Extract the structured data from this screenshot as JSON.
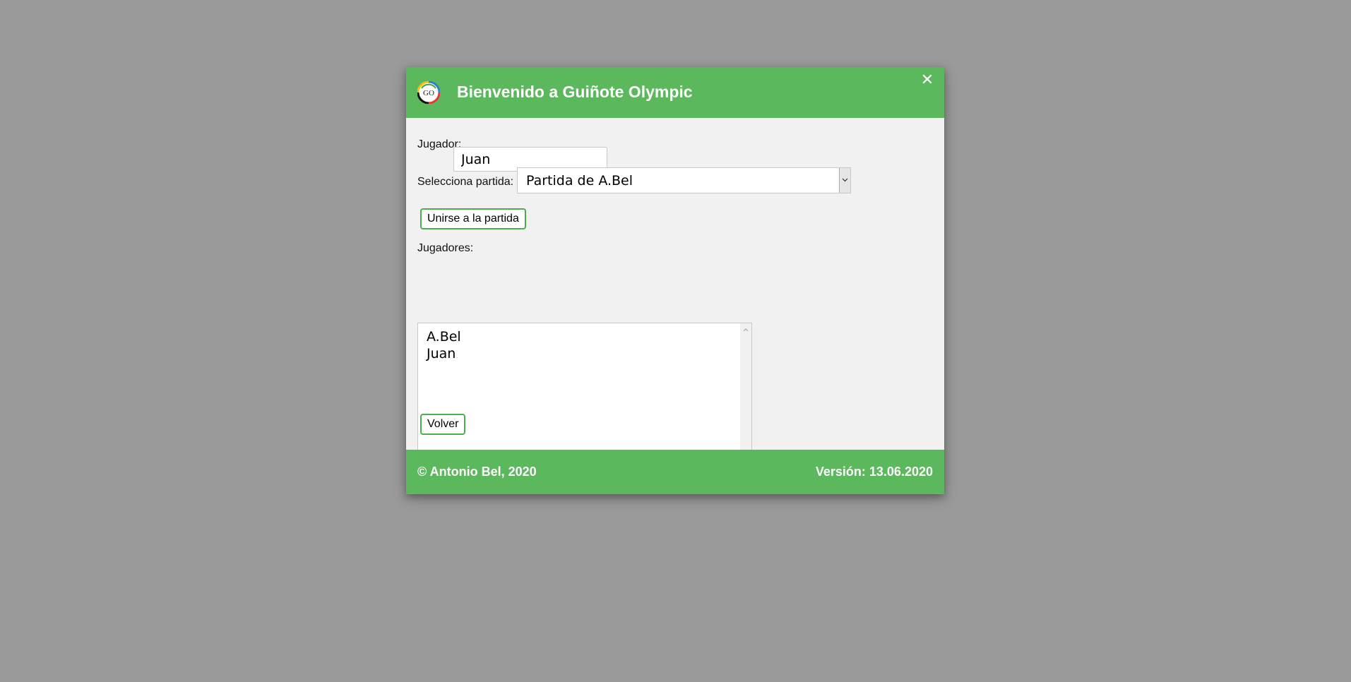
{
  "header": {
    "logo_text": "GO",
    "title": "Bienvenido a Guiñote Olympic",
    "close_icon": "close-icon"
  },
  "form": {
    "player_label": "Jugador:",
    "player_value": "Juan",
    "game_label": "Selecciona partida:",
    "game_selected": "Partida de A.Bel",
    "join_button": "Unirse a la partida",
    "players_label": "Jugadores:",
    "players": [
      "A.Bel",
      "Juan"
    ],
    "back_button": "Volver"
  },
  "footer": {
    "copyright": "© Antonio Bel, 2020",
    "version": "Versión: 13.06.2020"
  },
  "colors": {
    "accent": "#5cb85c",
    "button_border": "#4cae4c",
    "overlay": "#9a9a9a",
    "modal_bg": "#f1f1f1"
  }
}
